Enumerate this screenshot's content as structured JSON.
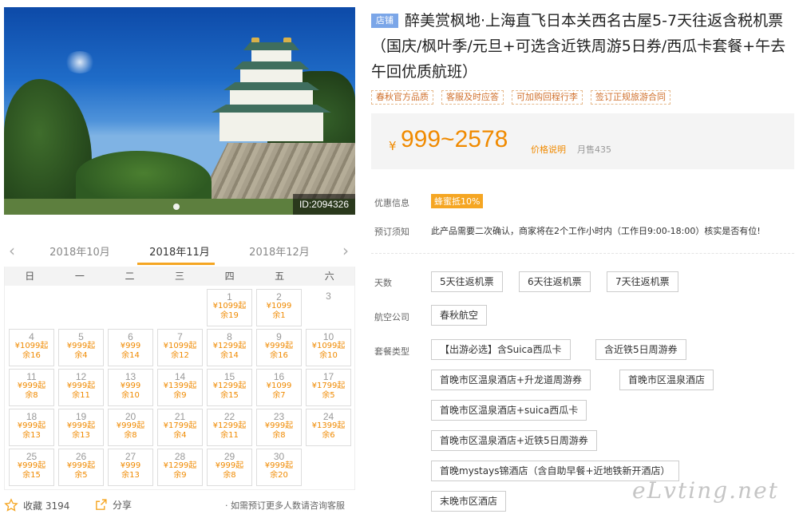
{
  "hero": {
    "id_tag": "ID:2094326"
  },
  "month_nav": {
    "prev": "2018年10月",
    "current": "2018年11月",
    "next": "2018年12月"
  },
  "calendar": {
    "weekdays": [
      "日",
      "一",
      "二",
      "三",
      "四",
      "五",
      "六"
    ],
    "days": [
      {
        "d": "1",
        "p": "¥1099起",
        "r": "余19"
      },
      {
        "d": "2",
        "p": "¥1099",
        "r": "余1"
      },
      {
        "d": "3",
        "p": "",
        "r": ""
      },
      {
        "d": "4",
        "p": "¥1099起",
        "r": "余16"
      },
      {
        "d": "5",
        "p": "¥999起",
        "r": "余4"
      },
      {
        "d": "6",
        "p": "¥999",
        "r": "余14"
      },
      {
        "d": "7",
        "p": "¥1099起",
        "r": "余12"
      },
      {
        "d": "8",
        "p": "¥1299起",
        "r": "余14"
      },
      {
        "d": "9",
        "p": "¥999起",
        "r": "余16"
      },
      {
        "d": "10",
        "p": "¥1099起",
        "r": "余10"
      },
      {
        "d": "11",
        "p": "¥999起",
        "r": "余8"
      },
      {
        "d": "12",
        "p": "¥999起",
        "r": "余11"
      },
      {
        "d": "13",
        "p": "¥999",
        "r": "余10"
      },
      {
        "d": "14",
        "p": "¥1399起",
        "r": "余9"
      },
      {
        "d": "15",
        "p": "¥1299起",
        "r": "余15"
      },
      {
        "d": "16",
        "p": "¥1099",
        "r": "余7"
      },
      {
        "d": "17",
        "p": "¥1799起",
        "r": "余5"
      },
      {
        "d": "18",
        "p": "¥999起",
        "r": "余13"
      },
      {
        "d": "19",
        "p": "¥999起",
        "r": "余13"
      },
      {
        "d": "20",
        "p": "¥999起",
        "r": "余8"
      },
      {
        "d": "21",
        "p": "¥1799起",
        "r": "余4"
      },
      {
        "d": "22",
        "p": "¥1299起",
        "r": "余11"
      },
      {
        "d": "23",
        "p": "¥999起",
        "r": "余8"
      },
      {
        "d": "24",
        "p": "¥1399起",
        "r": "余6"
      },
      {
        "d": "25",
        "p": "¥999起",
        "r": "余15"
      },
      {
        "d": "26",
        "p": "¥999起",
        "r": "余5"
      },
      {
        "d": "27",
        "p": "¥999",
        "r": "余13"
      },
      {
        "d": "28",
        "p": "¥1299起",
        "r": "余9"
      },
      {
        "d": "29",
        "p": "¥999起",
        "r": "余8"
      },
      {
        "d": "30",
        "p": "¥999起",
        "r": "余20"
      }
    ]
  },
  "footer": {
    "favorite": "收藏 3194",
    "share": "分享",
    "tip": "· 如需预订更多人数请咨询客服"
  },
  "product": {
    "shop_badge": "店铺",
    "title": "醉美赏枫地·上海直飞日本关西名古屋5-7天往返含税机票（国庆/枫叶季/元旦+可选含近铁周游5日券/西瓜卡套餐+午去午回优质航班）",
    "tags": [
      "春秋官方品质",
      "客服及时应答",
      "可加购回程行李",
      "签订正规旅游合同"
    ],
    "currency": "¥",
    "price": "999~2578",
    "price_explain": "价格说明",
    "monthly_sales": "月售435",
    "discount_label": "优惠信息",
    "discount_badge": "蜂蜜抵10%",
    "notice_label": "预订须知",
    "notice": "此产品需要二次确认，商家将在2个工作小时内（工作日9:00-18:00）核实是否有位!"
  },
  "options": {
    "days_label": "天数",
    "days": [
      "5天往返机票",
      "6天往返机票",
      "7天往返机票"
    ],
    "airline_label": "航空公司",
    "airline": "春秋航空",
    "package_label": "套餐类型",
    "packages": [
      "【出游必选】含Suica西瓜卡",
      "含近铁5日周游券",
      "首晚市区温泉酒店+升龙道周游券",
      "首晚市区温泉酒店",
      "首晚市区温泉酒店+suica西瓜卡",
      "首晚市区温泉酒店+近铁5日周游券",
      "首晚mystays锦酒店（含自助早餐+近地铁新开酒店）",
      "末晚市区酒店"
    ]
  },
  "watermark": "eLvting.net"
}
